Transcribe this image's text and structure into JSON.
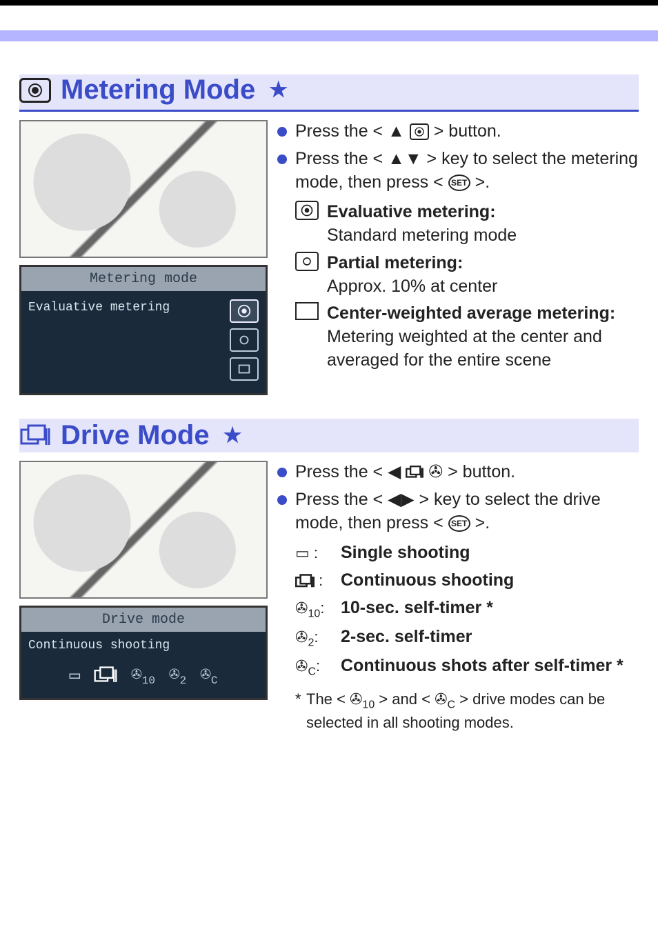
{
  "colors": {
    "accent": "#3a4cc7",
    "lcd_bg": "#1b2a3a"
  },
  "section_metering": {
    "title": "Metering Mode",
    "star": "★",
    "lcd": {
      "title": "Metering mode",
      "selected_label": "Evaluative metering"
    },
    "step1_pre": "Press the <",
    "step1_post": "> button.",
    "step2_pre": "Press the <",
    "step2_mid": "> key to select the metering mode, then press <",
    "step2_post": ">.",
    "set_label": "SET",
    "modes": {
      "evaluative": {
        "name": "Evaluative metering:",
        "desc": "Standard metering mode"
      },
      "partial": {
        "name": "Partial metering:",
        "desc": "Approx. 10% at center"
      },
      "center": {
        "name": "Center-weighted average metering:",
        "desc": "Metering weighted at the center and averaged for the entire scene"
      }
    }
  },
  "section_drive": {
    "title": "Drive Mode",
    "star": "★",
    "lcd": {
      "title": "Drive mode",
      "selected_label": "Continuous shooting"
    },
    "step1_pre": "Press the <",
    "step1_post": "> button.",
    "step2_pre": "Press the <",
    "step2_mid": "> key to select the drive mode, then press <",
    "step2_post": ">.",
    "set_label": "SET",
    "modes": {
      "single": {
        "icon": "□:",
        "name": "Single shooting"
      },
      "continuous": {
        "icon": "▭▯:",
        "name": "Continuous shooting"
      },
      "timer10": {
        "icon_prefix": "",
        "sub": "10",
        "colon": ":",
        "name": "10-sec. self-timer *"
      },
      "timer2": {
        "icon_prefix": "",
        "sub": "2",
        "colon": ":",
        "name": "2-sec. self-timer"
      },
      "timerC": {
        "icon_prefix": "",
        "sub": "C",
        "colon": ":",
        "name": "Continuous shots after self-timer *"
      }
    },
    "footnote_pre": "The <",
    "footnote_mid": "> and <",
    "footnote_post": "> drive modes can be selected in all shooting modes.",
    "footnote_sub1": "10",
    "footnote_sub2": "C"
  }
}
